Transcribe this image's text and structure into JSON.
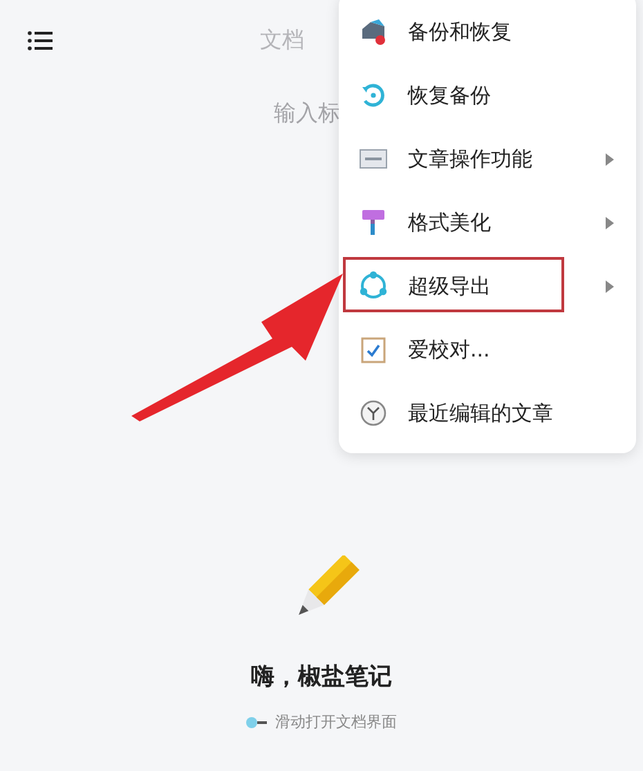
{
  "header": {
    "tab": "文档"
  },
  "title_field": {
    "placeholder": "输入标"
  },
  "menu": {
    "items": [
      {
        "kind": "backup",
        "label": "备份和恢复",
        "has_submenu": false,
        "highlighted": false
      },
      {
        "kind": "restore",
        "label": "恢复备份",
        "has_submenu": false,
        "highlighted": false
      },
      {
        "kind": "ctrl",
        "label": "文章操作功能",
        "has_submenu": true,
        "highlighted": false
      },
      {
        "kind": "brush",
        "label": "格式美化",
        "has_submenu": true,
        "highlighted": false
      },
      {
        "kind": "export",
        "label": "超级导出",
        "has_submenu": true,
        "highlighted": true
      },
      {
        "kind": "check",
        "label": "爱校对...",
        "has_submenu": false,
        "highlighted": false
      },
      {
        "kind": "clock",
        "label": "最近编辑的文章",
        "has_submenu": false,
        "highlighted": false
      }
    ]
  },
  "empty_state": {
    "title": "嗨，椒盐笔记",
    "hint": "滑动打开文档界面"
  }
}
